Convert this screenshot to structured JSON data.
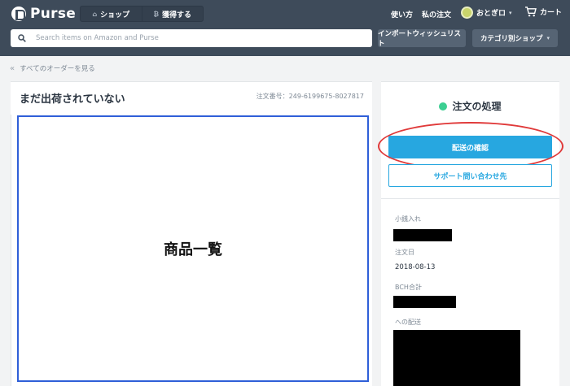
{
  "header": {
    "brand": "Purse",
    "segments": [
      {
        "label": "ショップ",
        "icon": "shop-icon"
      },
      {
        "label": "獲得する",
        "icon": "bitcoin-icon"
      }
    ],
    "nav": {
      "how_to": "使い方",
      "my_orders": "私の注文"
    },
    "user": {
      "name": "おとぎロ",
      "avatar_color": "#c9d46b"
    },
    "cart": {
      "label": "カート"
    },
    "search": {
      "placeholder": "Search items on Amazon and Purse",
      "value": ""
    },
    "import_button": "インポートウィッシュリスト",
    "category_button": "カテゴリ別ショップ"
  },
  "breadcrumb": {
    "back_label": "すべてのオーダーを見る"
  },
  "order": {
    "title": "まだ出荷されていない",
    "order_number": "注文番号：249-6199675-8027817",
    "items_placeholder": "商品一覧"
  },
  "side": {
    "status_label": "注文の処理",
    "status_color": "#3ccf92",
    "track_button": "配送の確認",
    "support_button": "サポート問い合わせ先",
    "fields": {
      "wallet_label": "小銭入れ",
      "date_label": "注文日",
      "date_value": "2018-08-13",
      "bch_label": "BCH合計",
      "shipping_label": "への配送"
    }
  },
  "colors": {
    "header_bg": "#3e4b5a",
    "accent": "#27a7e0",
    "highlight_oval": "#e03a3a",
    "items_border": "#2f5fd8"
  }
}
